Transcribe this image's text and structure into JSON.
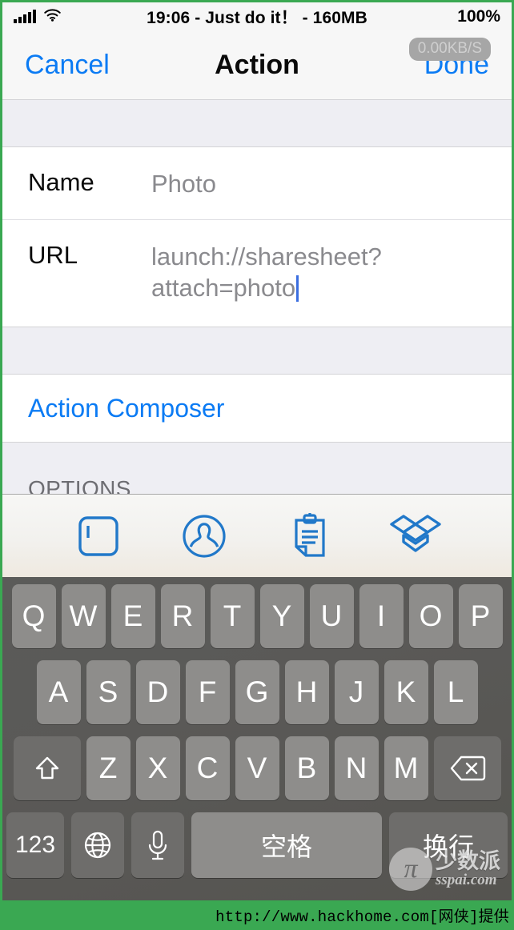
{
  "status_bar": {
    "signal_icon": "signal-bars-icon",
    "wifi_icon": "wifi-icon",
    "center_text": "19:06 - Just do it！ - 160MB",
    "battery_percent": "100%"
  },
  "nav_bar": {
    "cancel_label": "Cancel",
    "title": "Action",
    "done_label": "Done",
    "network_speed": "0.00KB/S",
    "accent_color": "#0b7bf4"
  },
  "form": {
    "rows": [
      {
        "label": "Name",
        "value": "Photo"
      },
      {
        "label": "URL",
        "value": "launch://sharesheet?attach=photo"
      }
    ],
    "composer_link": "Action Composer",
    "options_header": "OPTIONS"
  },
  "accessory_bar": {
    "icons": [
      {
        "name": "text-field-icon",
        "label": "Text Field"
      },
      {
        "name": "contact-icon",
        "label": "Contact"
      },
      {
        "name": "clipboard-icon",
        "label": "Clipboard"
      },
      {
        "name": "dropbox-icon",
        "label": "Dropbox"
      }
    ],
    "icon_color": "#2178c9"
  },
  "keyboard": {
    "row1": [
      "Q",
      "W",
      "E",
      "R",
      "T",
      "Y",
      "U",
      "I",
      "O",
      "P"
    ],
    "row2": [
      "A",
      "S",
      "D",
      "F",
      "G",
      "H",
      "J",
      "K",
      "L"
    ],
    "row3_letters": [
      "Z",
      "X",
      "C",
      "V",
      "B",
      "N",
      "M"
    ],
    "shift_icon": "shift-arrow-icon",
    "backspace_icon": "backspace-icon",
    "numeric_label": "123",
    "globe_icon": "globe-icon",
    "mic_icon": "microphone-icon",
    "space_label": "空格",
    "return_label": "换行",
    "key_color": "#8e8d8b",
    "background_color": "#575653"
  },
  "watermark": {
    "logo_glyph": "π",
    "name_cn": "少数派",
    "url": "sspai.com"
  },
  "footer": {
    "text": "http://www.hackhome.com[网侠]提供",
    "background_color": "#3aa852"
  }
}
